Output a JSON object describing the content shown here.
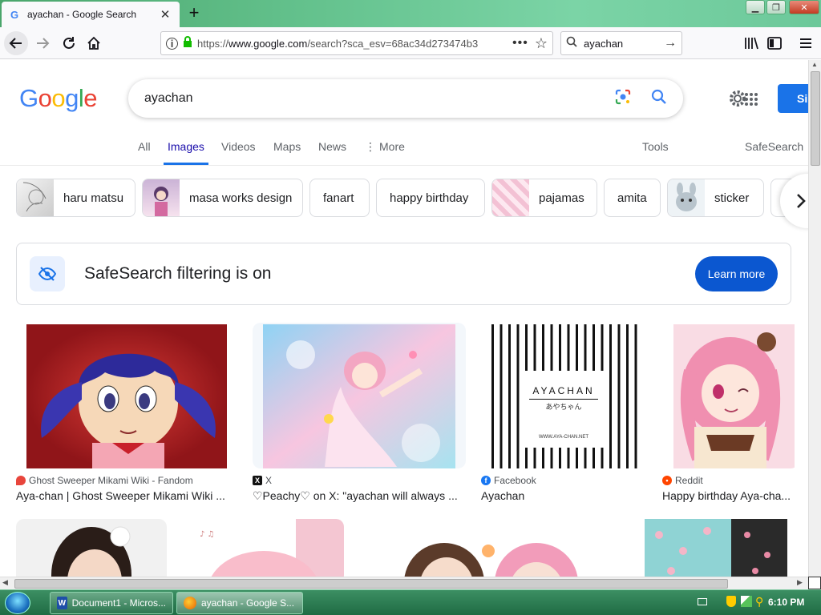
{
  "browser": {
    "tab_title": "ayachan - Google Search",
    "tab_favicon": "G",
    "url_prefix": "https://",
    "url_host": "www.google.com",
    "url_rest": "/search?sca_esv=68ac34d273474b3",
    "search_box": "ayachan",
    "icons": [
      "back-arrow-icon",
      "forward-arrow-icon",
      "reload-icon",
      "home-icon",
      "info-icon",
      "lock-icon",
      "page-actions-icon",
      "bookmark-star-icon",
      "search-icon",
      "library-icon",
      "sidebar-icon",
      "menu-icon"
    ]
  },
  "google": {
    "logo": [
      "G",
      "o",
      "o",
      "g",
      "l",
      "e"
    ],
    "logo_colors": [
      "#4285f4",
      "#ea4335",
      "#fbbc05",
      "#4285f4",
      "#34a853",
      "#ea4335"
    ],
    "query": "ayachan",
    "signin_label": "Si",
    "tabs": [
      "All",
      "Images",
      "Videos",
      "Maps",
      "News",
      "More"
    ],
    "tools_label": "Tools",
    "safesearch_label": "SafeSearch",
    "chips": [
      "haru matsu",
      "masa works design",
      "fanart",
      "happy birthday",
      "pajamas",
      "amita",
      "sticker"
    ],
    "banner_text": "SafeSearch filtering is on",
    "learn_more": "Learn more",
    "results": [
      {
        "source": "Ghost Sweeper Mikami Wiki - Fandom",
        "title": "Aya-chan | Ghost Sweeper Mikami Wiki ...",
        "source_color": "#e8453c"
      },
      {
        "source": "X",
        "title": "♡Peachy♡ on X: \"ayachan will always ...",
        "source_color": "#111111"
      },
      {
        "source": "Facebook",
        "title": "Ayachan",
        "source_color": "#1877f2"
      },
      {
        "source": "Reddit",
        "title": "Happy birthday Aya-cha...",
        "source_color": "#ff4500"
      }
    ],
    "aya_image_text": "AYACHAN",
    "aya_image_kana": "あやちゃん",
    "aya_image_url": "WWW.AYA-CHAN.NET"
  },
  "taskbar": {
    "tasks": [
      "Document1 - Micros...",
      "ayachan - Google S..."
    ],
    "clock": "6:10 PM"
  }
}
